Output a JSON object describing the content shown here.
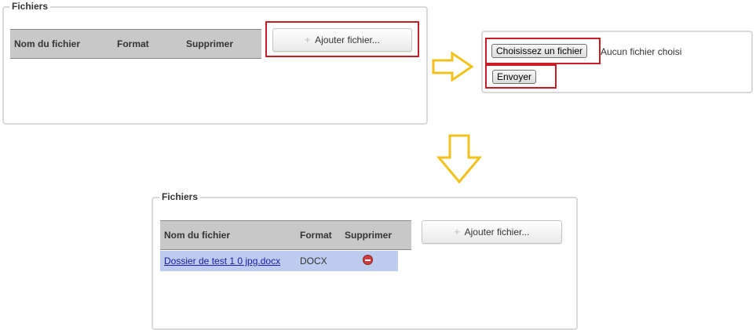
{
  "step1": {
    "legend": "Fichiers",
    "columns": [
      "Nom du fichier",
      "Format",
      "Supprimer"
    ],
    "add_button": "Ajouter fichier..."
  },
  "step2": {
    "choose_button": "Choisissez un fichier",
    "no_file_text": "Aucun fichier choisi",
    "send_button": "Envoyer"
  },
  "step3": {
    "legend": "Fichiers",
    "columns": [
      "Nom du fichier",
      "Format",
      "Supprimer"
    ],
    "add_button": "Ajouter fichier...",
    "rows": [
      {
        "name": "Dossier de test 1 0 jpg.docx",
        "format": "DOCX",
        "delete_icon": "minus-circle-icon"
      }
    ]
  },
  "colors": {
    "highlight": "#c81d25",
    "arrow": "#f1c21b",
    "row_bg": "#bccbee"
  }
}
